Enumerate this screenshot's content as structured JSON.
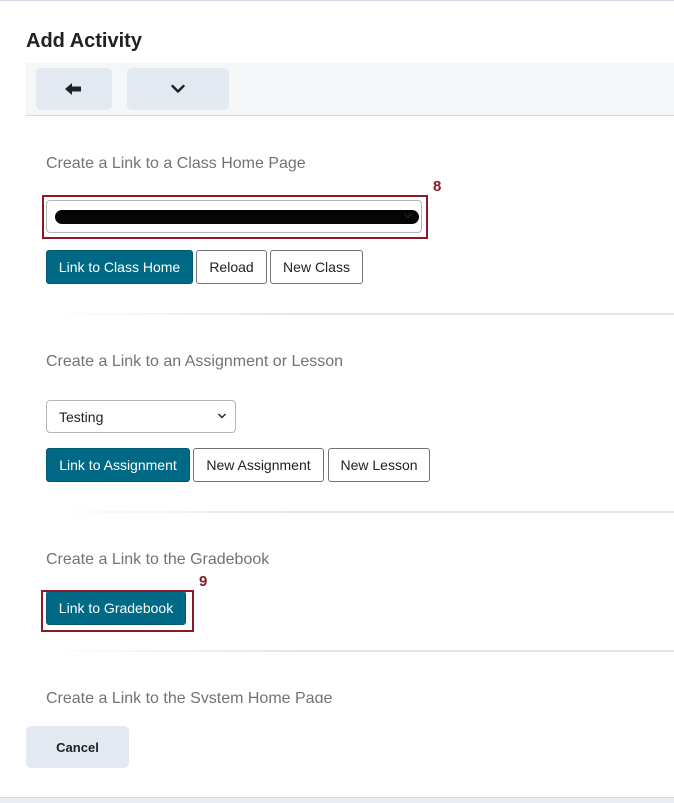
{
  "dialog": {
    "title": "Add Activity"
  },
  "toolbar": {
    "back_icon": "arrow-left-icon",
    "more_icon": "chevron-down-icon"
  },
  "sections": {
    "class_home": {
      "label": "Create a Link to a Class Home Page",
      "select_value": "",
      "callout_number": "8",
      "buttons": {
        "link": "Link to Class Home",
        "reload": "Reload",
        "new_class": "New Class"
      }
    },
    "assignment": {
      "label": "Create a Link to an Assignment or Lesson",
      "select_value": "Testing",
      "buttons": {
        "link": "Link to Assignment",
        "new_assignment": "New Assignment",
        "new_lesson": "New Lesson"
      }
    },
    "gradebook": {
      "label": "Create a Link to the Gradebook",
      "callout_number": "9",
      "buttons": {
        "link": "Link to Gradebook"
      }
    },
    "system_home": {
      "label": "Create a Link to the System Home Page"
    }
  },
  "footer": {
    "cancel": "Cancel"
  },
  "colors": {
    "primary_button": "#006a86",
    "callout": "#8b1a25",
    "toolbar_button": "#e3e9f1"
  }
}
